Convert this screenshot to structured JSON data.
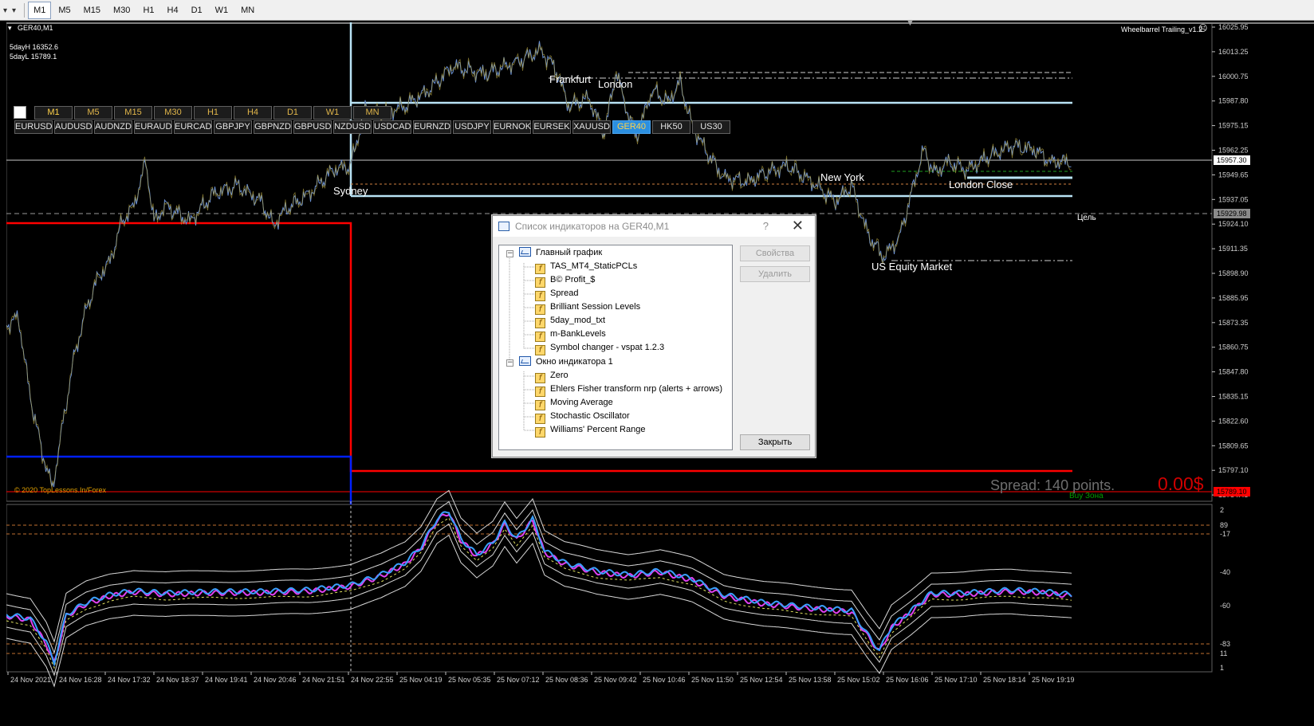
{
  "toolbar": {
    "dropdown_glyph": "▾",
    "timeframes": [
      "M1",
      "M5",
      "M15",
      "M30",
      "H1",
      "H4",
      "D1",
      "W1",
      "MN"
    ],
    "active": "M1"
  },
  "chart": {
    "symbol_title": "GER40,M1",
    "five_day_high": "5dayH 16352.6",
    "five_day_low": "5dayL 15789.1",
    "ea_name": "Wheelbarrel Trailing_v1.2",
    "copyright": "© 2020 TopLessons.In/Forex",
    "spread_text": "Spread: 140 points.",
    "profit_text": "0.00$",
    "buy_zone": "Buy Зона",
    "target_label": "Цель",
    "sessions": [
      "Sydney",
      "Frankfurt",
      "London",
      "New York",
      "London Close",
      "US Equity Market"
    ],
    "price_axis": [
      "16025.95",
      "16013.25",
      "16000.75",
      "15987.80",
      "15975.15",
      "15962.25",
      "15949.65",
      "15937.05",
      "15924.10",
      "15911.35",
      "15898.90",
      "15885.95",
      "15873.35",
      "15860.75",
      "15847.80",
      "15835.15",
      "15822.60",
      "15809.65",
      "15797.10",
      "15784.45"
    ],
    "current_price": "15957.30",
    "target_price": "15929.98",
    "low_price": "15789.10",
    "sub_axis": [
      "2",
      "89",
      "-17",
      "-40",
      "-60",
      "-83",
      "11",
      "1"
    ],
    "time_axis": [
      "24 Nov 2021",
      "24 Nov 16:28",
      "24 Nov 17:32",
      "24 Nov 18:37",
      "24 Nov 19:41",
      "24 Nov 20:46",
      "24 Nov 21:51",
      "24 Nov 22:55",
      "25 Nov 04:19",
      "25 Nov 05:35",
      "25 Nov 07:12",
      "25 Nov 08:36",
      "25 Nov 09:42",
      "25 Nov 10:46",
      "25 Nov 11:50",
      "25 Nov 12:54",
      "25 Nov 13:58",
      "25 Nov 15:02",
      "25 Nov 16:06",
      "25 Nov 17:10",
      "25 Nov 18:14",
      "25 Nov 19:19"
    ]
  },
  "symbol_changer": {
    "timeframes": [
      "M1",
      "M5",
      "M15",
      "M30",
      "H1",
      "H4",
      "D1",
      "W1",
      "MN"
    ],
    "current_tf": "M1",
    "symbols": [
      "EURUSD",
      "AUDUSD",
      "AUDNZD",
      "EURAUD",
      "EURCAD",
      "GBPJPY",
      "GBPNZD",
      "GBPUSD",
      "NZDUSD",
      "USDCAD",
      "EURNZD",
      "USDJPY",
      "EURNOK",
      "EURSEK",
      "XAUUSD",
      "GER40",
      "HK50",
      "US30"
    ],
    "selected": "GER40"
  },
  "dialog": {
    "title": "Список индикаторов на GER40,M1",
    "help": "?",
    "close": "✕",
    "main_chart": "Главный график",
    "main_items": [
      "TAS_MT4_StaticPCLs",
      "B© Profit_$",
      "Spread",
      "Brilliant Session Levels",
      "5day_mod_txt",
      "m-BankLevels",
      "Symbol changer - vspat 1.2.3"
    ],
    "sub_window": "Окно индикатора 1",
    "sub_items": [
      "Zero",
      "Ehlers Fisher transform nrp (alerts + arrows)",
      "Moving Average",
      "Stochastic Oscillator",
      "Williams' Percent Range"
    ],
    "btn_properties": "Свойства",
    "btn_delete": "Удалить",
    "btn_close": "Закрыть"
  },
  "colors": {
    "bg": "#000000",
    "price_line": "#6a8fd0",
    "session_line": "#b9e3f5",
    "red_level": "#ff0000",
    "blue_level": "#0020ff",
    "selected_symbol": "#2b8fe0",
    "osc_magenta": "#e040f0",
    "osc_blue": "#3aa0ff"
  }
}
